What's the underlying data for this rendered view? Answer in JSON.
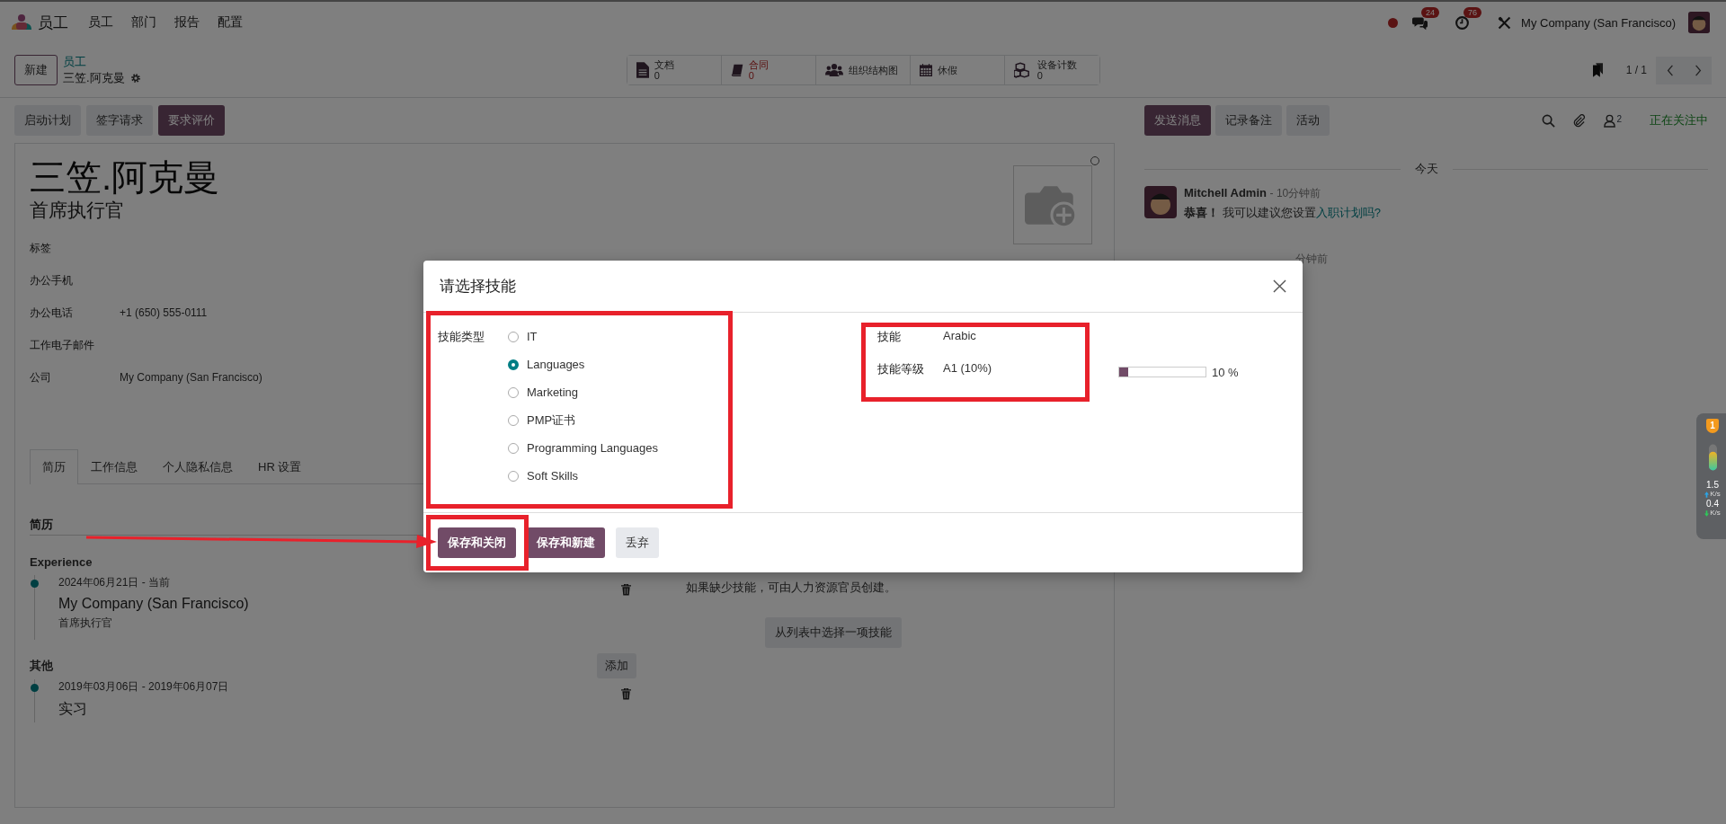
{
  "top_nav": {
    "app_name": "员工",
    "menus": [
      "员工",
      "部门",
      "报告",
      "配置"
    ],
    "chat_badge": "24",
    "activity_badge": "76",
    "company": "My Company (San Francisco)"
  },
  "control_panel": {
    "new_button": "新建",
    "breadcrumb": "员工",
    "record": "三笠.阿克曼",
    "smart_buttons": [
      {
        "kind": "file",
        "label": "文档",
        "value": "0",
        "alert": false
      },
      {
        "kind": "book",
        "label": "合同",
        "value": "0",
        "alert": true
      },
      {
        "kind": "people",
        "label": "组织结构图",
        "alert": false
      },
      {
        "kind": "calendar",
        "label": "休假",
        "alert": false
      },
      {
        "kind": "cubes",
        "label": "设备计数",
        "value": "0",
        "alert": false
      }
    ],
    "pager": "1 / 1"
  },
  "header_buttons": [
    {
      "label": "启动计划",
      "primary": false
    },
    {
      "label": "签字请求",
      "primary": false
    },
    {
      "label": "要求评价",
      "primary": true
    }
  ],
  "form": {
    "name": "三笠.阿克曼",
    "job_title": "首席执行官",
    "fields": [
      {
        "label": "标签"
      },
      {
        "label": "办公手机"
      },
      {
        "label": "办公电话",
        "value": "+1 (650) 555-0111"
      },
      {
        "label": "工作电子邮件"
      },
      {
        "label": "公司",
        "value": "My Company (San Francisco)"
      }
    ],
    "tabs": [
      {
        "label": "简历",
        "selected": true
      },
      {
        "label": "工作信息",
        "selected": false
      },
      {
        "label": "个人隐私信息",
        "selected": false
      },
      {
        "label": "HR 设置",
        "selected": false
      }
    ],
    "resume": {
      "title": "简历",
      "sections": [
        {
          "name": "Experience",
          "entries": [
            {
              "dates": "2024年06月21日 - 当前",
              "title": "My Company (San Francisco)",
              "subtitle": "首席执行官"
            }
          ]
        },
        {
          "name": "其他",
          "add_button": "添加",
          "entries": [
            {
              "dates": "2019年03月06日 - 2019年06月07日",
              "title": "实习"
            }
          ]
        }
      ]
    },
    "skills": {
      "hint": "如果缺少技能，可由人力资源官员创建。",
      "button": "从列表中选择一项技能"
    }
  },
  "chatter": {
    "buttons": [
      {
        "label": "发送消息",
        "primary": true
      },
      {
        "label": "记录备注",
        "primary": false
      },
      {
        "label": "活动",
        "primary": false
      }
    ],
    "follower_count": "2",
    "follow_status": "正在关注中",
    "date_separator": "今天",
    "messages": [
      {
        "author": "Mitchell Admin",
        "time": "- 10分钟前",
        "text": "**恭喜！** 我可以建议您设置",
        "link": "入职计划吗?"
      }
    ],
    "partial_time": "分钟前"
  },
  "dialog": {
    "title": "请选择技能",
    "skill_type_label": "技能类型",
    "skill_types": [
      {
        "label": "IT",
        "selected": false
      },
      {
        "label": "Languages",
        "selected": true
      },
      {
        "label": "Marketing",
        "selected": false
      },
      {
        "label": "PMP证书",
        "selected": false
      },
      {
        "label": "Programming Languages",
        "selected": false
      },
      {
        "label": "Soft Skills",
        "selected": false
      }
    ],
    "skill_label": "技能",
    "skill": "Arabic",
    "level_label": "技能等级",
    "level_value": "A1 (10%)",
    "level": 0.1,
    "level_reading": "10 %",
    "buttons": [
      {
        "label": "保存和关闭",
        "primary": true
      },
      {
        "label": "保存和新建",
        "primary": true
      },
      {
        "label": "丢弃",
        "primary": false
      }
    ]
  },
  "net_widget": {
    "alerts": "1",
    "upload": "1.5",
    "upload_unit": "K/s",
    "download": "0.4",
    "download_unit": "K/s"
  }
}
